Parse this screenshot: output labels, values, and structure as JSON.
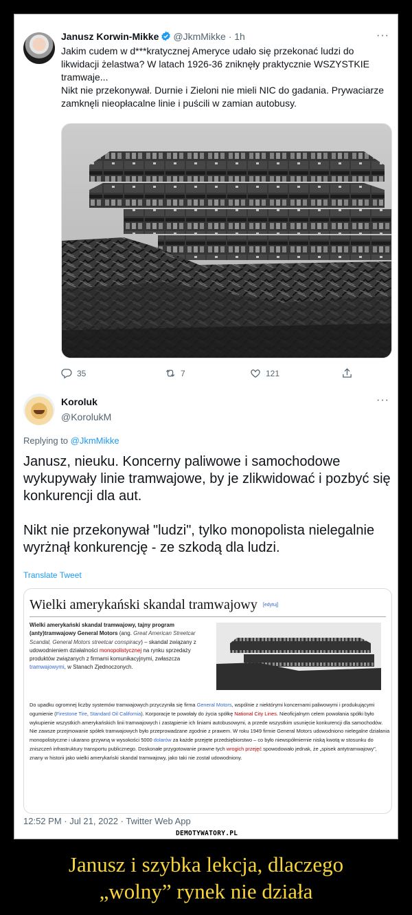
{
  "tweet1": {
    "author_name": "Janusz Korwin-Mikke",
    "handle_time": "@JkmMikke · 1h",
    "more": "···",
    "text_lines": [
      "Jakim cudem w d***kratycznej Ameryce udało się przekonać ludzi do",
      "likwidacji żelastwa? W latach 1926-36 zniknęły praktycznie WSZYSTKIE",
      "tramwaje...",
      "Nikt nie przekonywał. Durnie i Zieloni nie mieli NIC do gadania. Prywaciarze",
      "zamknęli nieopłacalne linie i puścili w zamian autobusy."
    ],
    "replies": "35",
    "retweets": "7",
    "likes": "121"
  },
  "tweet2": {
    "author_name": "Koroluk",
    "handle": "@KorolukM",
    "more": "···",
    "replying_prefix": "Replying to ",
    "replying_to": "@JkmMikke",
    "paragraph1": "Janusz, nieuku. Koncerny paliwowe i samochodowe wykupywały linie tramwajowe, by je zlikwidować i pozbyć się konkurencji dla aut.",
    "paragraph2": "Nikt nie przekonywał \"ludzi\", tylko monopolista nielegalnie wyrżnął konkurencję - ze szkodą dla ludzi.",
    "translate": "Translate Tweet",
    "timestamp": "12:52 PM · Jul 21, 2022 · Twitter Web App"
  },
  "wiki": {
    "title": "Wielki amerykański skandal tramwajowy",
    "edit": "[edytuj]",
    "lead": {
      "bold": "Wielki amerykański skandal tramwajowy, tajny program (anty)tramwajowy General Motors",
      "p1": " (ang. ",
      "italic": "Great American Streetcar Scandal, General Motors streetcar conspiracy",
      "p2": ") – skandal związany z udowodnieniem działalności ",
      "link1": "monopolistycznej",
      "p3": " na rynku sprzedaży produktów związanych z firmami komunikacyjnymi, zwłaszcza ",
      "link2": "tramwajowymi",
      "p4": ", w Stanach Zjednoczonych."
    },
    "body": {
      "s1": "Do upadku ogromnej liczby systemów tramwajowych przyczyniła się firma ",
      "l1": "General Motors",
      "s2": ", wspólnie z niektórymi koncernami paliwowymi i produkującymi ogumienie (",
      "l2": "Firestone Tire",
      "s3": ", ",
      "l3": "Standard Oil California",
      "s4": "). Korporacje te powołały do życia spółkę ",
      "r1": "National City Lines",
      "s5": ". Nieoficjalnym celem powołania spółki było wykupienie wszystkich amerykańskich linii tramwajowych i zastąpienie ich liniami autobusowymi, a przede wszystkim usunięcie konkurencji dla samochodów. Nie zawsze przejmowanie spółek tramwajowych było przeprowadzane zgodnie z prawem. W roku 1949 firmie General Motors udowodniono nielegalne działania monopolistyczne i ukarano grzywną w wysokości 5000 ",
      "l4": "dolarów",
      "s6": " za każde przejęte przedsiębiorstwo – co było niewspółmiernie niską kwotą w stosunku do zniszczeń infrastruktury transportu publicznego. Doskonałe przygotowanie prawne tych ",
      "l5": "wrogich przejęć",
      "s7": " spowodowało jednak, że „spisek antytramwajowy”, znany w historii jako wielki amerykański skandal tramwajowy, jako taki nie został udowodniony."
    }
  },
  "watermark": "DEMOTYWATORY.PL",
  "caption_line1": "Janusz i szybka lekcja, dlaczego",
  "caption_line2": "„wolny” rynek nie działa",
  "colors": {
    "link_blue": "#1d9bf0",
    "caption_yellow": "#f8d53d",
    "wiki_link": "#3366cc",
    "wiki_redlink": "#ba0000"
  }
}
